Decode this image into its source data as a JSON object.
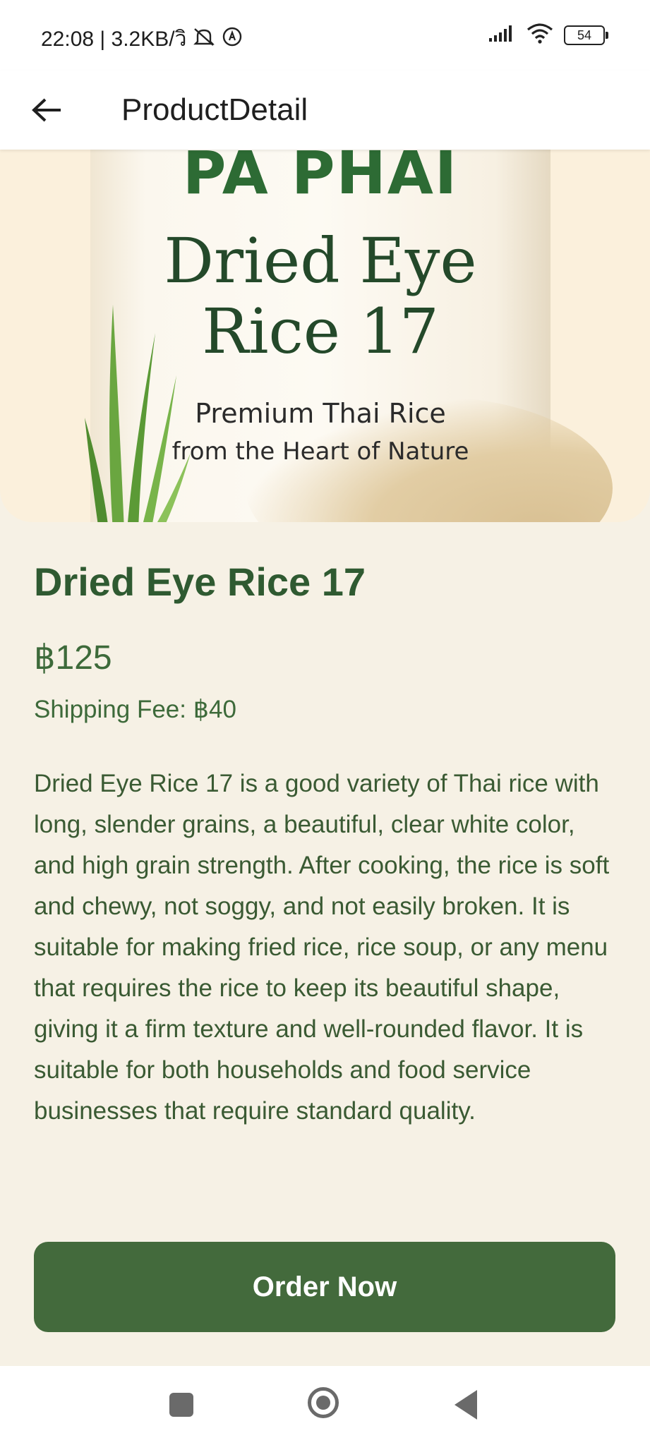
{
  "status_bar": {
    "time_and_speed": "22:08 | 3.2KB/วิ",
    "battery": "54"
  },
  "app_bar": {
    "title": "ProductDetail"
  },
  "hero": {
    "brand": "PA PHAI",
    "name_line1": "Dried Eye",
    "name_line2": "Rice 17",
    "tagline1": "Premium Thai Rice",
    "tagline2": "from the Heart of Nature"
  },
  "product": {
    "title": "Dried Eye Rice 17",
    "price": "฿125",
    "shipping": "Shipping Fee: ฿40",
    "description": "Dried Eye Rice 17 is a good variety of Thai rice with long, slender grains, a beautiful, clear white color, and high grain strength. After cooking, the rice is soft and chewy, not soggy, and not easily broken. It is suitable for making fried rice, rice soup, or any menu that requires the rice to keep its beautiful shape, giving it a firm texture and well-rounded flavor. It is suitable for both households and food service businesses that require standard quality."
  },
  "actions": {
    "order_label": "Order Now"
  },
  "colors": {
    "primary": "#436a3c",
    "background": "#f6f1e5",
    "text": "#3a5a33"
  }
}
